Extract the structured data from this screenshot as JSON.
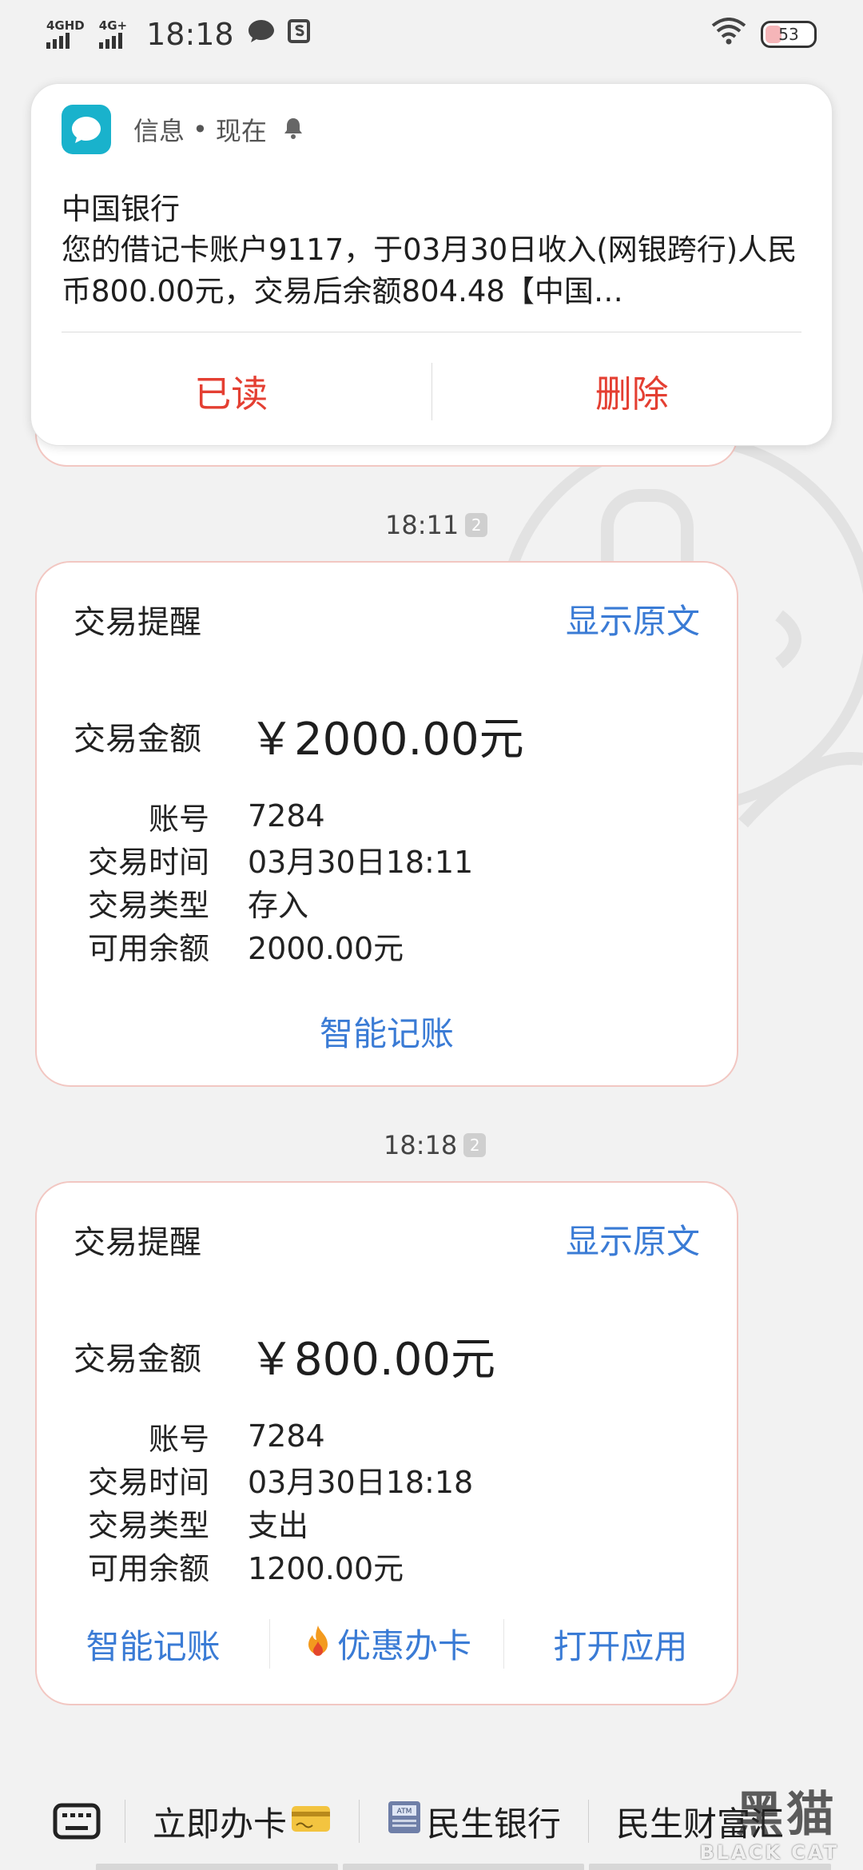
{
  "status_bar": {
    "sim1_label": "4GHD",
    "sim2_label": "4G+",
    "time": "18:18",
    "battery": "53"
  },
  "notification": {
    "app_name": "信息",
    "separator": "•",
    "when": "现在",
    "title": "中国银行",
    "body": "您的借记卡账户9117，于03月30日收入(网银跨行)人民币800.00元，交易后余额804.48【中国…",
    "actions": {
      "read": "已读",
      "delete": "删除"
    }
  },
  "messages": [
    {
      "timestamp": "18:11",
      "sim_badge": "2",
      "card": {
        "title": "交易提醒",
        "show_original": "显示原文",
        "amount_label": "交易金额",
        "amount_value": "￥2000.00元",
        "rows": [
          {
            "label": "账号",
            "value": "7284"
          },
          {
            "label": "交易时间",
            "value": "03月30日18:11"
          },
          {
            "label": "交易类型",
            "value": "存入"
          },
          {
            "label": "可用余额",
            "value": "2000.00元"
          }
        ],
        "footer": [
          "智能记账"
        ]
      }
    },
    {
      "timestamp": "18:18",
      "sim_badge": "2",
      "card": {
        "title": "交易提醒",
        "show_original": "显示原文",
        "amount_label": "交易金额",
        "amount_value": "￥800.00元",
        "rows": [
          {
            "label": "账号",
            "value": "7284"
          },
          {
            "label": "交易时间",
            "value": "03月30日18:18"
          },
          {
            "label": "交易类型",
            "value": "支出"
          },
          {
            "label": "可用余额",
            "value": "1200.00元"
          }
        ],
        "footer": [
          "智能记账",
          "优惠办卡",
          "打开应用"
        ]
      }
    }
  ],
  "bottom_menu": {
    "items": [
      "立即办卡",
      "民生银行",
      "民生财富汇"
    ]
  },
  "watermark": {
    "main": "黑猫",
    "sub": "BLACK CAT"
  },
  "colors": {
    "link_blue": "#3a7bd5",
    "action_red": "#e43f32",
    "card_border": "#f2c7c2",
    "app_icon": "#19b2cc"
  }
}
